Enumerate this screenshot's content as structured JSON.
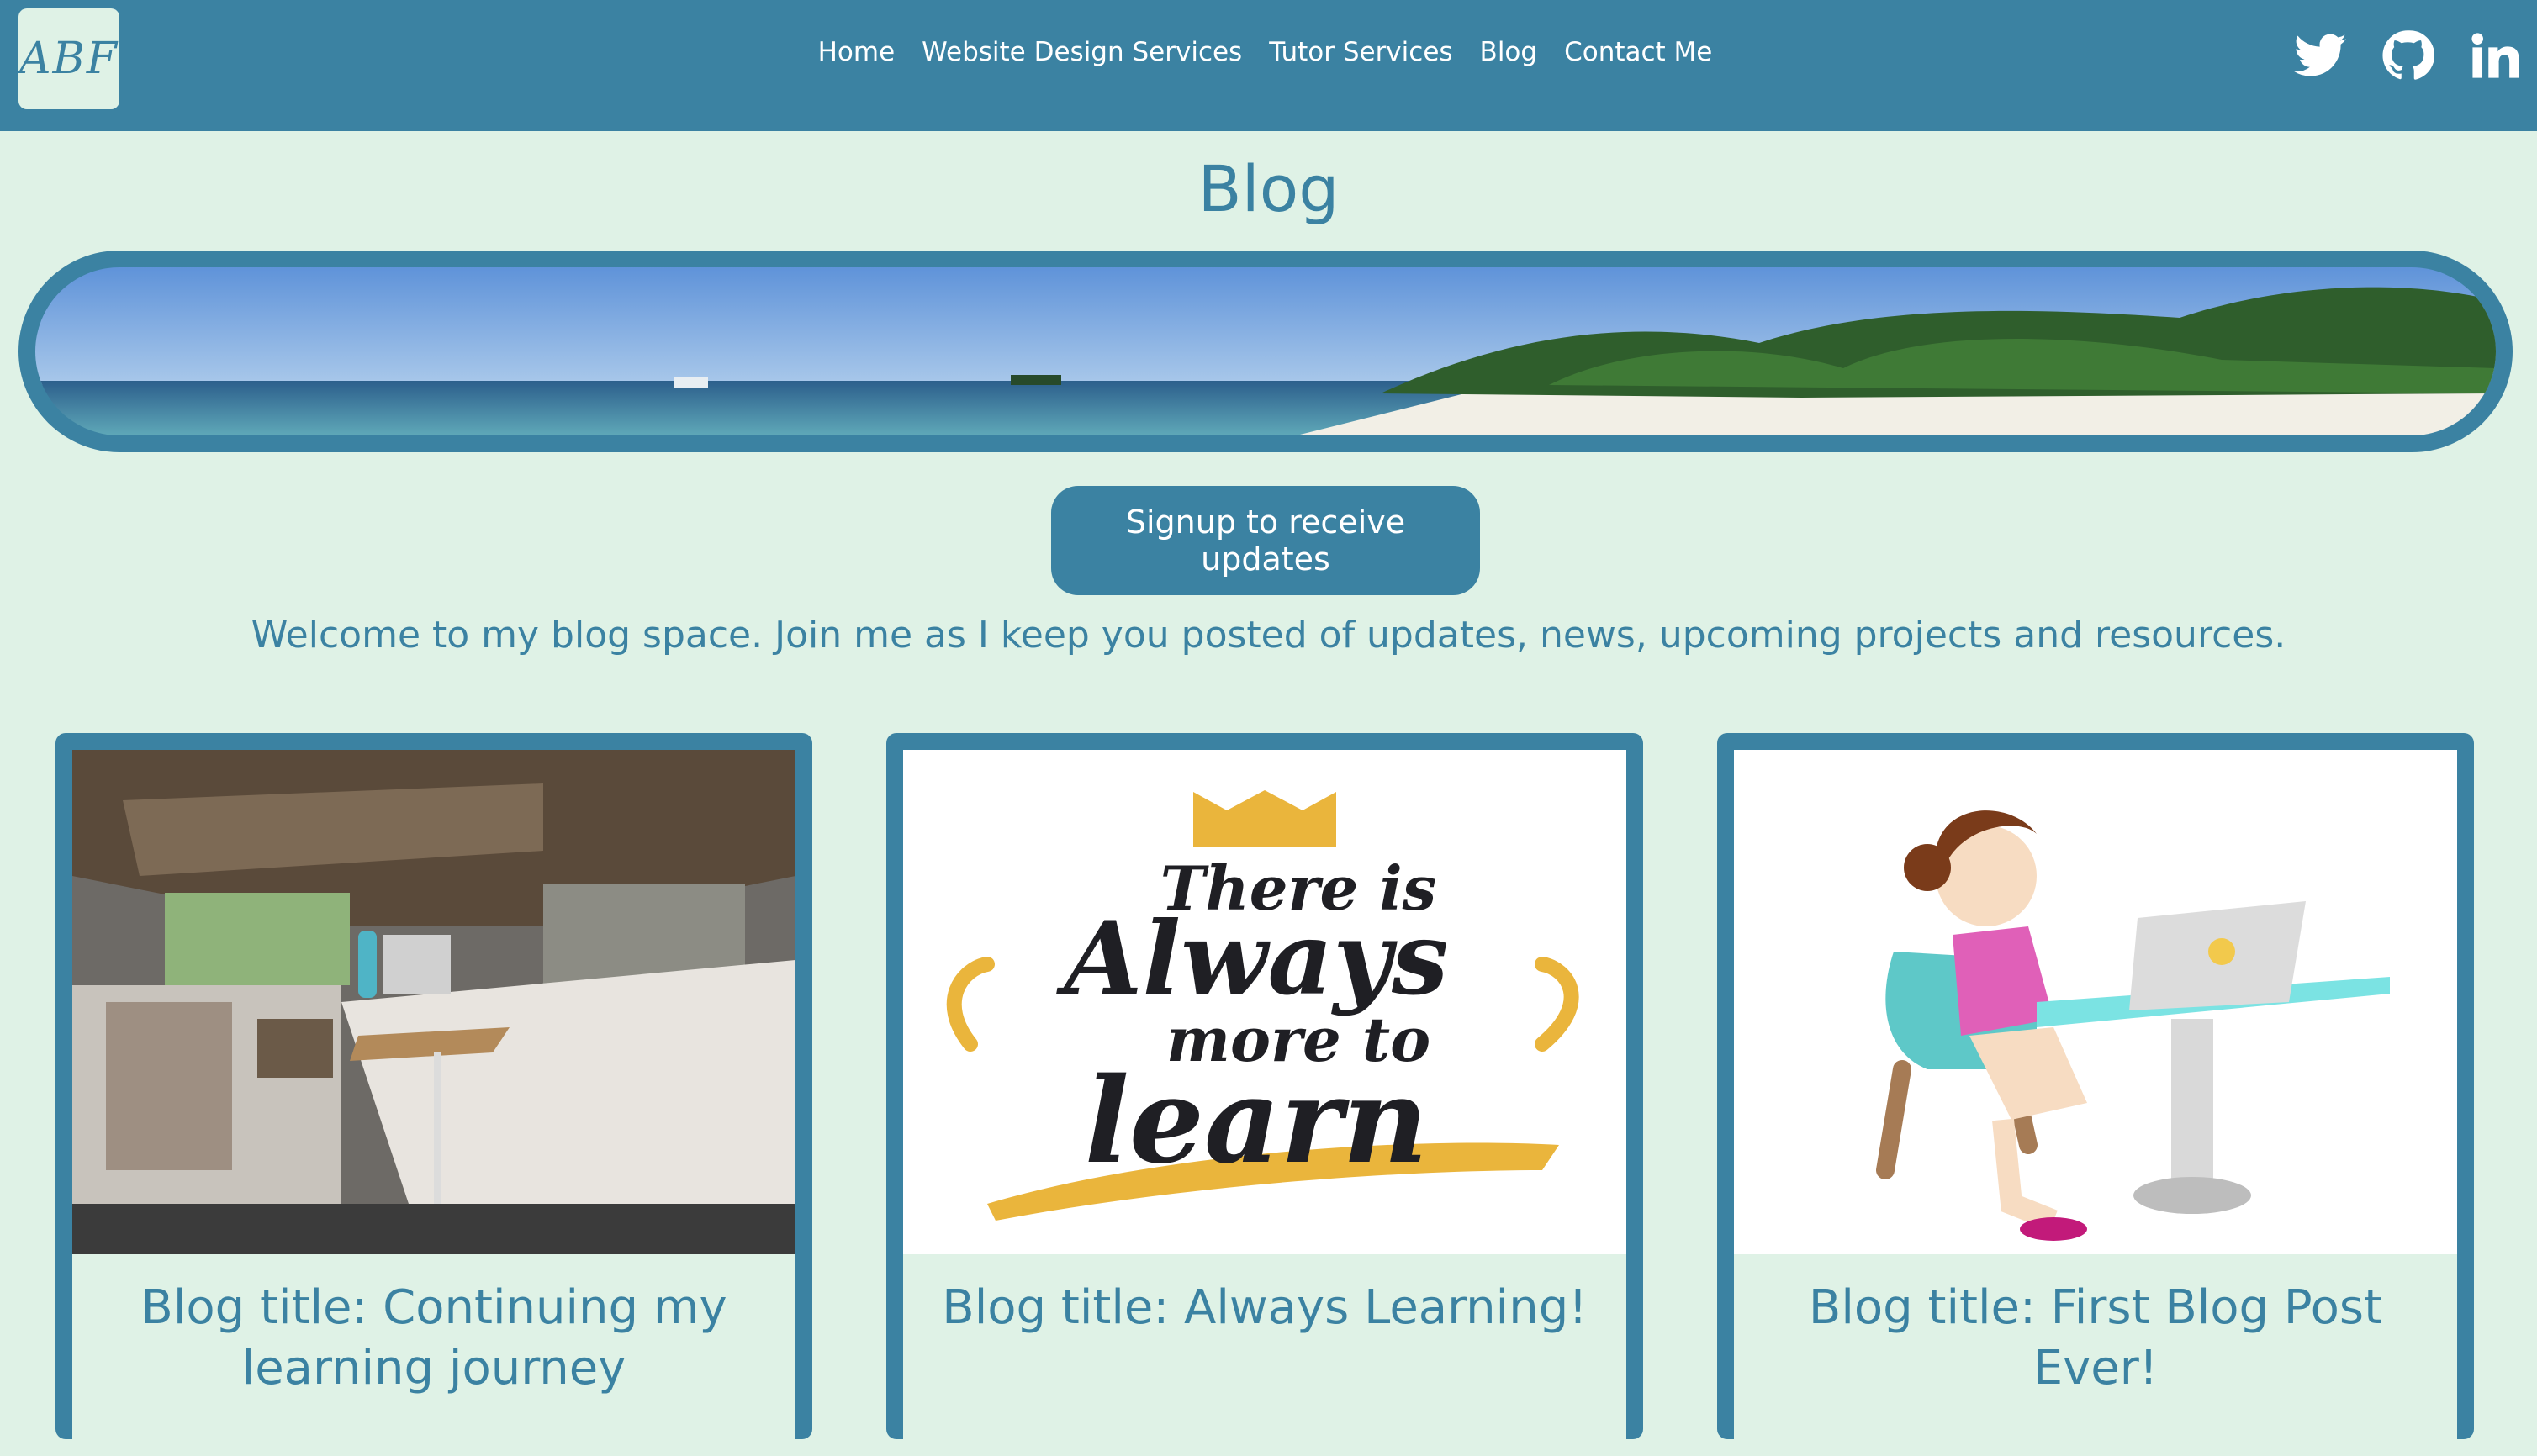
{
  "nav": {
    "logo_text": "ABF",
    "links": [
      "Home",
      "Website Design Services",
      "Tutor Services",
      "Blog",
      "Contact Me"
    ],
    "social_icons": [
      "twitter-icon",
      "github-icon",
      "linkedin-icon"
    ]
  },
  "page": {
    "title": "Blog",
    "signup_label": "Signup to receive updates",
    "welcome": "Welcome to my blog space. Join me as I keep you posted of updates, news, upcoming projects and resources."
  },
  "cards": [
    {
      "title": "Blog title: Continuing my learning journey"
    },
    {
      "title": "Blog title: Always Learning!",
      "image_text": [
        "There is",
        "Always",
        "more to",
        "learn"
      ]
    },
    {
      "title": "Blog title: First Blog Post Ever!"
    }
  ],
  "colors": {
    "primary": "#3b82a2",
    "background": "#dff2e6",
    "white": "#ffffff"
  }
}
